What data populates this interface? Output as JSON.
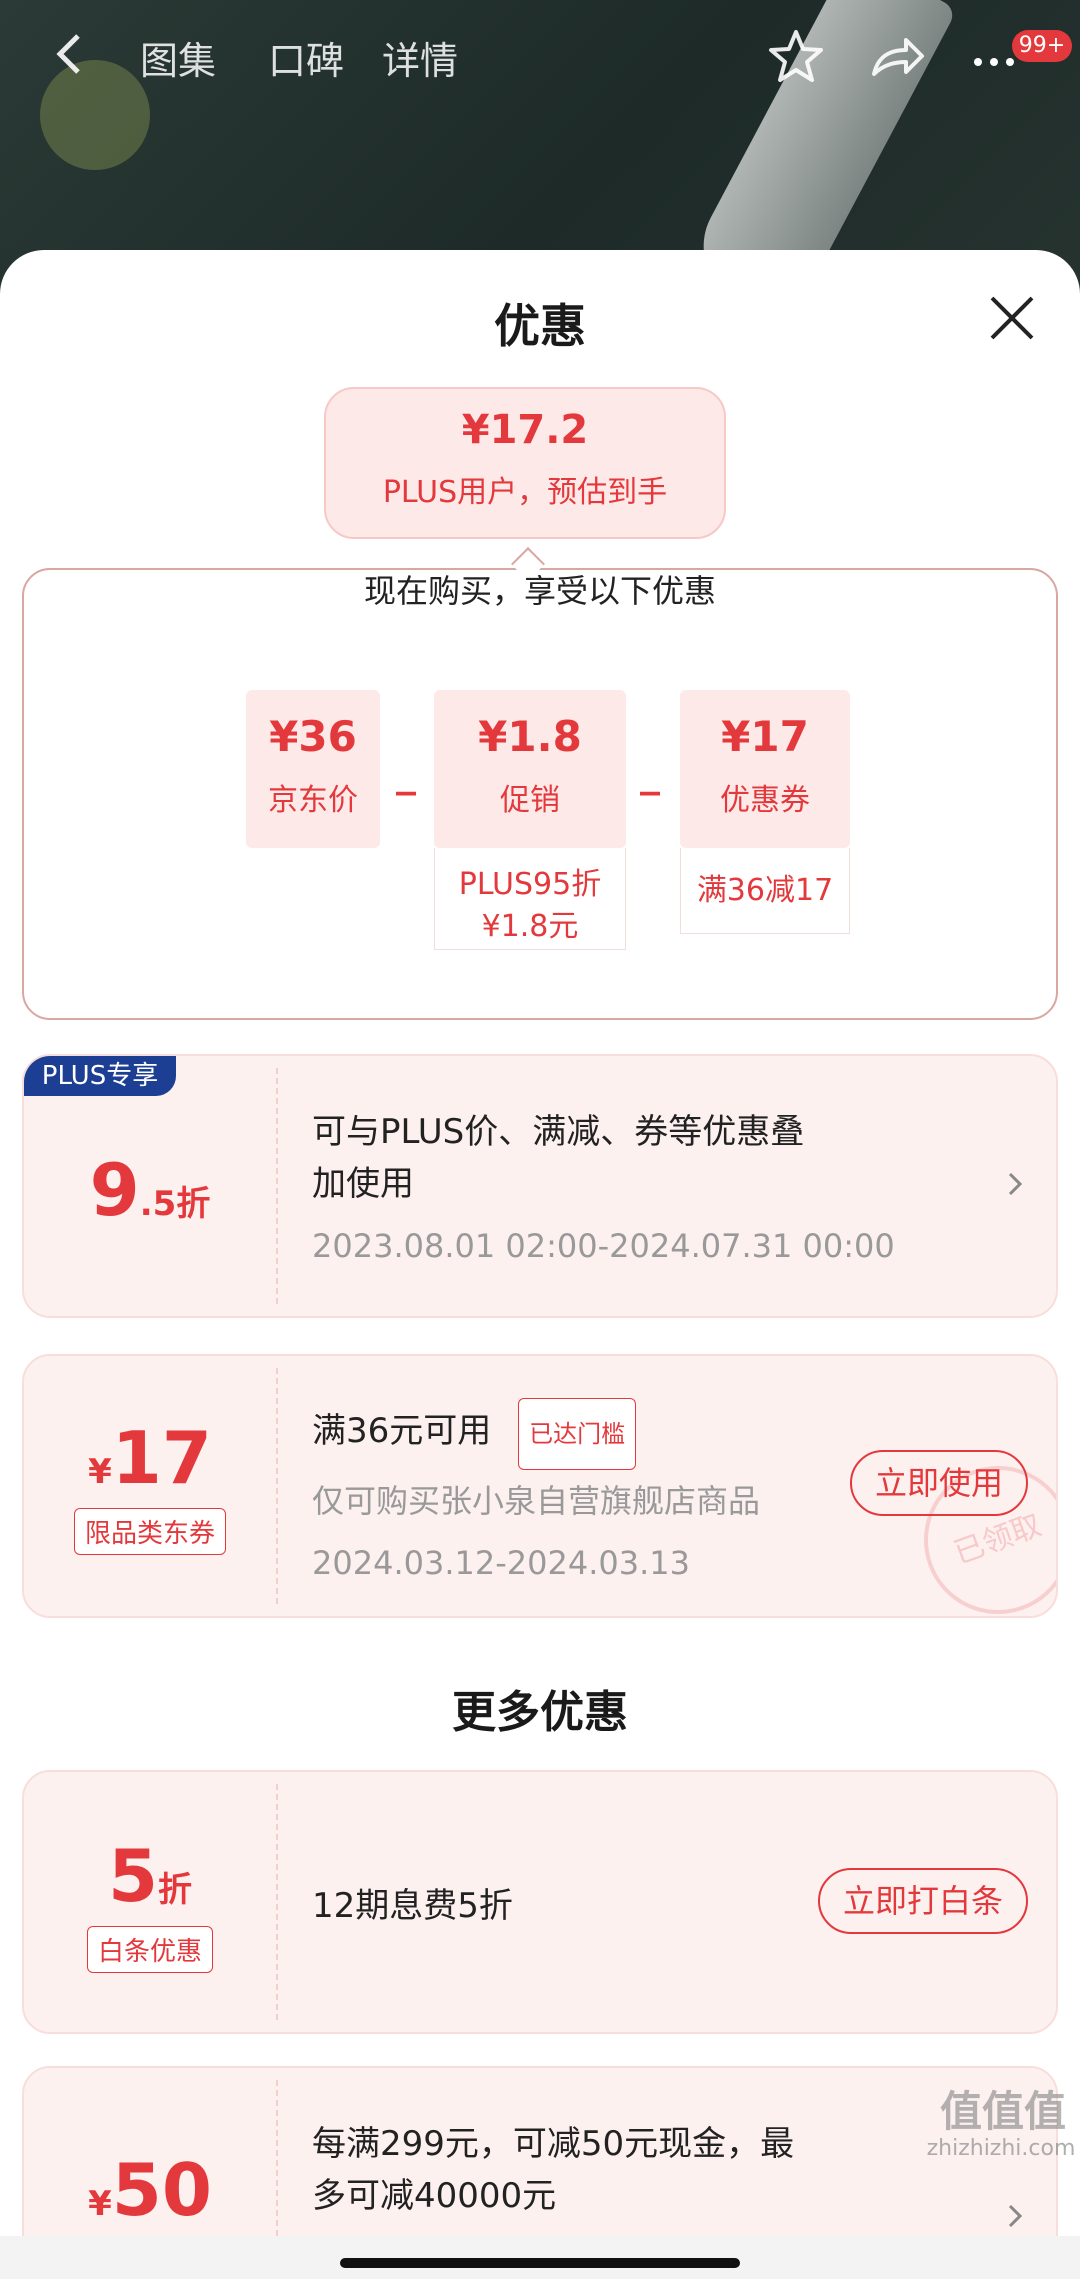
{
  "header": {
    "tabs": [
      "图集",
      "口碑",
      "详情"
    ],
    "badge": "99+"
  },
  "sheet": {
    "title": "优惠",
    "estimate": {
      "price": "¥17.2",
      "label": "PLUS用户，预估到手"
    },
    "calc": {
      "heading": "现在购买，享受以下优惠",
      "cells": [
        {
          "value": "¥36",
          "label": "京东价"
        },
        {
          "value": "¥1.8",
          "label": "促销",
          "detail1": "PLUS95折",
          "detail2": "¥1.8元"
        },
        {
          "value": "¥17",
          "label": "优惠券",
          "detail1": "满36减17"
        }
      ],
      "minus": "_"
    }
  },
  "coupons": [
    {
      "badge": "PLUS专享",
      "big": "9",
      "small": ".5折",
      "line1": "可与PLUS价、满减、券等优惠叠",
      "line2": "加使用",
      "date": "2023.08.01 02:00-2024.07.31 00:00"
    },
    {
      "currency": "¥",
      "big": "17",
      "tag": "限品类东券",
      "title": "满36元可用",
      "status": "已达门槛",
      "desc": "仅可购买张小泉自营旗舰店商品",
      "date": "2024.03.12-2024.03.13",
      "action": "立即使用",
      "stamp": "已领取"
    }
  ],
  "more": {
    "title": "更多优惠",
    "items": [
      {
        "big": "5",
        "small": "折",
        "tag": "白条优惠",
        "text": "12期息费5折",
        "action": "立即打白条"
      },
      {
        "currency": "¥",
        "big": "50",
        "line1": "每满299元，可减50元现金，最",
        "line2": "多可减40000元"
      }
    ]
  },
  "watermark": {
    "main": "值值值",
    "sub": "zhizhizhi.com"
  },
  "colors": {
    "accent": "#e4393c",
    "plus": "#1c3f94",
    "card_bg": "#fdf1f0"
  }
}
